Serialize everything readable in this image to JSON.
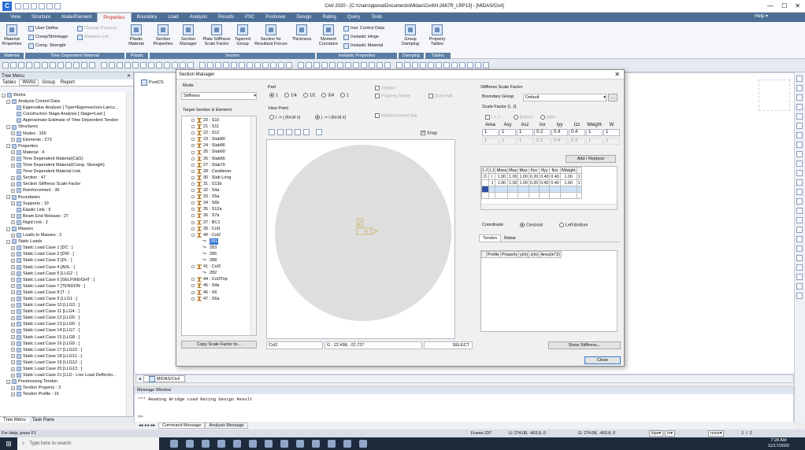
{
  "window": {
    "title": "Civil 2020 - [C:\\Users\\ppena\\Documents\\Midas\\Civil\\H-2667R_LRP13] - [MIDAS/Civil]"
  },
  "menu": {
    "items": [
      "View",
      "Structure",
      "Node/Element",
      "Properties",
      "Boundary",
      "Load",
      "Analysis",
      "Results",
      "PSC",
      "Pushover",
      "Design",
      "Rating",
      "Query",
      "Tools"
    ],
    "active": "Properties",
    "help": "Help"
  },
  "ribbon": {
    "material_properties": "Material Properties",
    "user_define": "User Define",
    "creep_shrinkage": "Creep/Shrinkage",
    "comp_strength": "Comp. Strength",
    "change_property": "Change Property",
    "material_link": "Material Link",
    "plastic_material": "Plastic Material",
    "section_properties": "Section Properties",
    "section_manager": "Section Manager",
    "plate_stiffness": "Plate Stiffness Scale Factor",
    "tapered_group": "Tapered Group",
    "section_resultant": "Section for Resultant Forces",
    "thickness": "Thickness",
    "moment_curvature": "Moment Curvature",
    "inel_control": "Inel. Control Data",
    "inelastic_hinge": "Inelastic Hinge",
    "inelastic_material": "Inelastic Material",
    "group_damping": "Group Damping",
    "property_tables": "Property Tables",
    "groups": [
      "Material",
      "Time Dependent Material",
      "Plastic",
      "Section",
      "Inelastic Properties",
      "Damping",
      "Tables"
    ]
  },
  "left_panel": {
    "header": "Tree Menu",
    "tabs": [
      "Tables",
      "Works",
      "Group",
      "Report"
    ],
    "tree": [
      {
        "label": "Works",
        "level": 0,
        "exp": "-"
      },
      {
        "label": "Analysis Control Data",
        "level": 1,
        "exp": "-"
      },
      {
        "label": "Eigenvalue Analysis [ Type=Eigenvectors-Lancz...",
        "level": 2,
        "exp": ""
      },
      {
        "label": "Construction Stage Analysis [ Stage=Last ]",
        "level": 2,
        "exp": ""
      },
      {
        "label": "Approximate Estimate of Time Dependent Tendon",
        "level": 2,
        "exp": ""
      },
      {
        "label": "Structures",
        "level": 1,
        "exp": "-"
      },
      {
        "label": "Nodes : 165",
        "level": 2,
        "exp": "+"
      },
      {
        "label": "Elements : 273",
        "level": 2,
        "exp": "+"
      },
      {
        "label": "Properties",
        "level": 1,
        "exp": "-"
      },
      {
        "label": "Material : 4",
        "level": 2,
        "exp": "+"
      },
      {
        "label": "Time Dependent Material(C&S)",
        "level": 2,
        "exp": "+"
      },
      {
        "label": "Time Dependent Material(Comp. Strength)",
        "level": 2,
        "exp": "+"
      },
      {
        "label": "Time Dependent Material Link",
        "level": 2,
        "exp": ""
      },
      {
        "label": "Section : 47",
        "level": 2,
        "exp": "+"
      },
      {
        "label": "Section Stiffness Scale Factor",
        "level": 2,
        "exp": "+"
      },
      {
        "label": "Reinforcement : 30",
        "level": 2,
        "exp": "+"
      },
      {
        "label": "Boundaries",
        "level": 1,
        "exp": "-"
      },
      {
        "label": "Supports : 10",
        "level": 2,
        "exp": "+"
      },
      {
        "label": "Elastic Link : 5",
        "level": 2,
        "exp": ""
      },
      {
        "label": "Beam End Release : 27",
        "level": 2,
        "exp": "+"
      },
      {
        "label": "Rigid Link : 2",
        "level": 2,
        "exp": "+"
      },
      {
        "label": "Masses",
        "level": 1,
        "exp": "-"
      },
      {
        "label": "Loads to Masses : 2",
        "level": 2,
        "exp": "+"
      },
      {
        "label": "Static Loads",
        "level": 1,
        "exp": "-"
      },
      {
        "label": "Static Load Case 1 [DC : ]",
        "level": 2,
        "exp": "+"
      },
      {
        "label": "Static Load Case 2 [DW : ]",
        "level": 2,
        "exp": "+"
      },
      {
        "label": "Static Load Case 3 [DL : ]",
        "level": 2,
        "exp": "+"
      },
      {
        "label": "Static Load Case 4 [ADL : ]",
        "level": 2,
        "exp": "+"
      },
      {
        "label": "Static Load Case 5 [LLG2 : ]",
        "level": 2,
        "exp": "+"
      },
      {
        "label": "Static Load Case 6 [SELFWEIGHT : ]",
        "level": 2,
        "exp": "+"
      },
      {
        "label": "Static Load Case 7 [TENDON : ]",
        "level": 2,
        "exp": "+"
      },
      {
        "label": "Static Load Case 8 [T : ]",
        "level": 2,
        "exp": "+"
      },
      {
        "label": "Static Load Case 9 [LLG1 : ]",
        "level": 2,
        "exp": "+"
      },
      {
        "label": "Static Load Case 10 [LLG3 : ]",
        "level": 2,
        "exp": "+"
      },
      {
        "label": "Static Load Case 11 [LLG4 : ]",
        "level": 2,
        "exp": "+"
      },
      {
        "label": "Static Load Case 12 [LLG5 : ]",
        "level": 2,
        "exp": "+"
      },
      {
        "label": "Static Load Case 13 [LLG6 : ]",
        "level": 2,
        "exp": "+"
      },
      {
        "label": "Static Load Case 14 [LLG7 : ]",
        "level": 2,
        "exp": "+"
      },
      {
        "label": "Static Load Case 15 [LLG8 : ]",
        "level": 2,
        "exp": "+"
      },
      {
        "label": "Static Load Case 16 [LLG9 : ]",
        "level": 2,
        "exp": "+"
      },
      {
        "label": "Static Load Case 17 [LLG10 : ]",
        "level": 2,
        "exp": "+"
      },
      {
        "label": "Static Load Case 18 [LLG11 : ]",
        "level": 2,
        "exp": "+"
      },
      {
        "label": "Static Load Case 19 [LLG12 : ]",
        "level": 2,
        "exp": "+"
      },
      {
        "label": "Static Load Case 20 [LLG13 : ]",
        "level": 2,
        "exp": "+"
      },
      {
        "label": "Static Load Case 21 [LLD : Live Load Deflectio...",
        "level": 2,
        "exp": "+"
      },
      {
        "label": "Prestressing Tendon",
        "level": 1,
        "exp": "-"
      },
      {
        "label": "Tendon Property : 3",
        "level": 2,
        "exp": "+"
      },
      {
        "label": "Tendon Profile : 15",
        "level": 2,
        "exp": "+"
      }
    ],
    "bottom_tabs": [
      "Tree Menu",
      "Task Pane"
    ]
  },
  "workspace": {
    "postcs": "PostCS",
    "tab": "MIDAS/Civil"
  },
  "dialog": {
    "title": "Section Manager",
    "mode_label": "Mode",
    "mode_value": "Stiffness",
    "target_label": "Target Section & Element",
    "sections": [
      {
        "t": "s",
        "label": "20 : S10"
      },
      {
        "t": "s",
        "label": "21 : S11"
      },
      {
        "t": "s",
        "label": "22 : S12"
      },
      {
        "t": "s",
        "label": "23 : Slab80"
      },
      {
        "t": "s",
        "label": "24 : Slab86"
      },
      {
        "t": "s",
        "label": "25 : Slab60"
      },
      {
        "t": "s",
        "label": "26 : Slab66"
      },
      {
        "t": "s",
        "label": "27 : Slab70"
      },
      {
        "t": "s",
        "label": "28 : Cantilever"
      },
      {
        "t": "s",
        "label": "30 : Slab Long"
      },
      {
        "t": "s",
        "label": "31 : S13b"
      },
      {
        "t": "s",
        "label": "32 : S4a"
      },
      {
        "t": "s",
        "label": "33 : S5a"
      },
      {
        "t": "s",
        "label": "34 : S6b"
      },
      {
        "t": "s",
        "label": "35 : S12a"
      },
      {
        "t": "s",
        "label": "36 : S7a"
      },
      {
        "t": "s",
        "label": "37 : BC1"
      },
      {
        "t": "s",
        "label": "39 : Col1"
      },
      {
        "t": "s",
        "label": "40 : Col2"
      },
      {
        "t": "e",
        "label": "281",
        "sel": true
      },
      {
        "t": "e",
        "label": "283"
      },
      {
        "t": "e",
        "label": "286"
      },
      {
        "t": "e",
        "label": "288"
      },
      {
        "t": "s",
        "label": "41 : Col3"
      },
      {
        "t": "e",
        "label": "282"
      },
      {
        "t": "s",
        "label": "44 : Col3Top"
      },
      {
        "t": "s",
        "label": "45 : S4a"
      },
      {
        "t": "s",
        "label": "46 : S6"
      },
      {
        "t": "s",
        "label": "47 : S6a"
      }
    ],
    "copy_btn": "Copy Scale Factor to...",
    "part_label": "Part",
    "parts": [
      "1",
      "1/4",
      "1/2",
      "3/4",
      "1"
    ],
    "tendon": "Tendon",
    "property_name": "Property Name",
    "duct_hall": "Duct Hall",
    "reinforcement_bar": "Reinforcement Bar",
    "viewpoint_label": "View Point",
    "vp1": "i -> j (local x)",
    "vp2": "j -> i (local x)",
    "snap": "Snap",
    "axis_z": "Z",
    "axis_y": "Y",
    "status_section": "Col2",
    "status_coord": "G : 22.498, -22.727",
    "status_mode": "SELECT",
    "stiffness_title": "Stiffness Scale Factor",
    "boundary_group_label": "Boundary Group",
    "boundary_group_value": "Default",
    "scale_factor_label": "Scale Factor (I, J)",
    "sf_ij": "I = J",
    "sf_before": "Before",
    "sf_after": "After",
    "sf_headers": [
      "Area",
      "Asy",
      "Asz",
      "Ixx",
      "Iyy",
      "Izz",
      "Weight",
      "W"
    ],
    "sf_row1": [
      "1",
      "1",
      "1",
      "0.2",
      "0.4",
      "0.4",
      "1",
      "1"
    ],
    "sf_row2": [
      "1",
      "1",
      "1",
      "0.2",
      "0.4",
      "0.4",
      "1",
      "1"
    ],
    "add_replace": "Add / Replace",
    "grid_headers": [
      "I-J",
      "I,J",
      "fArea",
      "fAsy",
      "fAsz",
      "fIxx",
      "fIyy",
      "fIzz",
      "fWeight"
    ],
    "grid_rows": [
      {
        "elem": "O",
        "part": "I",
        "vals": [
          "1.00",
          "1.00",
          "1.00",
          "0.20",
          "0.40",
          "0.40",
          "1.00",
          "1"
        ]
      },
      {
        "elem": "",
        "part": "J",
        "vals": [
          "1.00",
          "1.00",
          "1.00",
          "0.20",
          "0.40",
          "0.40",
          "1.00",
          "1"
        ]
      }
    ],
    "coordinate_label": "Coordinate",
    "centroid": "Centroid",
    "left_bottom": "Left-Bottom",
    "tab_tendon": "Tendon",
    "tab_rebar": "Rebar",
    "tendon_headers": [
      "Profile",
      "Property",
      "y(in)",
      "z(in)",
      "Area(in^2)"
    ],
    "show_stiffness": "Show Stiffness...",
    "close": "Close"
  },
  "message_window": {
    "title": "Message Window",
    "text": "*** Reading Bridge Load Rating Design Result",
    "prompt": ">>",
    "tabs": [
      "Command Message",
      "Analysis Message"
    ]
  },
  "statusbar": {
    "left": "For Help, press F1",
    "frame": "Frame-237",
    "u": "U: 274.08, -403.8, 0",
    "g": "G: 274.08, -403.8, 0",
    "unit_force": "kips",
    "unit_length": "in",
    "unit_temp": "none",
    "page": "1",
    "total": "2"
  },
  "taskbar": {
    "search": "Type here to search",
    "time": "7:28 AM",
    "date": "11/17/2020"
  }
}
